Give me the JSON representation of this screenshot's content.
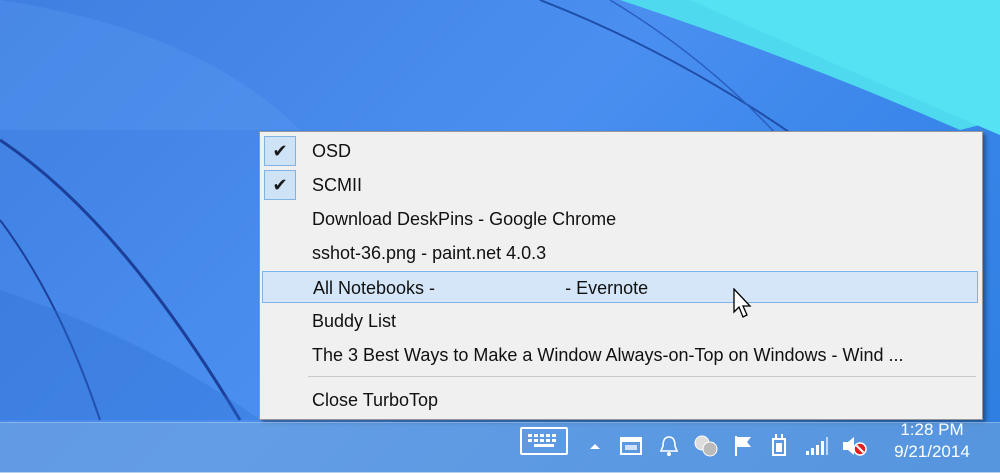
{
  "menu": {
    "items": [
      {
        "label": "OSD",
        "checked": true
      },
      {
        "label": "SCMII",
        "checked": true
      },
      {
        "label": "Download DeskPins - Google Chrome",
        "checked": false
      },
      {
        "label": "sshot-36.png - paint.net 4.0.3",
        "checked": false
      },
      {
        "label": "All Notebooks -                          - Evernote",
        "checked": false,
        "hovered": true
      },
      {
        "label": "Buddy List",
        "checked": false
      },
      {
        "label": "The 3 Best Ways to Make a Window Always-on-Top on Windows - Wind ...",
        "checked": false
      }
    ],
    "close_label": "Close TurboTop",
    "check_glyph": "✔"
  },
  "taskbar": {
    "time": "1:28 PM",
    "date": "9/21/2014",
    "tray_icons": [
      "keyboard-icon",
      "chevron-up-icon",
      "window-icon",
      "bell-icon",
      "chat-icon",
      "flag-icon",
      "power-plug-icon",
      "signal-bars-icon",
      "speaker-muted-icon"
    ]
  },
  "colors": {
    "desktop_blue": "#3f7fe0",
    "menu_bg": "#f0f0f0",
    "hover_bg": "#d4e6f8",
    "check_bg": "#cfe3f7"
  }
}
